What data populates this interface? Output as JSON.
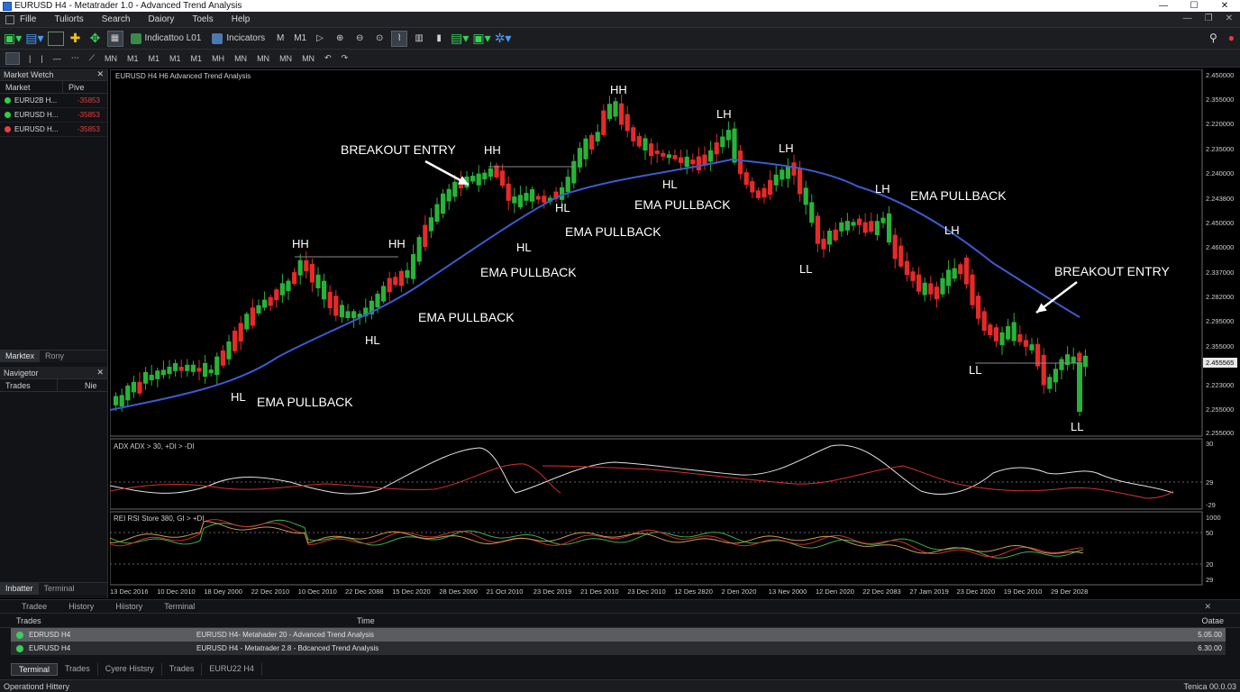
{
  "window": {
    "title": "EURUSD H4 - Metatrader 1.0 - Advanced Trend Analysis"
  },
  "menu": [
    "Fille",
    "Tuliorts",
    "Search",
    "Daiory",
    "Toels",
    "Help"
  ],
  "toolbar": {
    "indicators1": "Indicattoo L01",
    "indicators2": "Incicators",
    "tf_labels": [
      "M",
      "M1"
    ],
    "timeframes": [
      "MN",
      "M1",
      "M1",
      "M1",
      "M1",
      "MH",
      "MN",
      "MN",
      "MN",
      "MN"
    ]
  },
  "market_watch": {
    "title": "Market Wetch",
    "col_market": "Market",
    "col_price": "Pive",
    "rows": [
      {
        "symbol": "EURU2B H...",
        "price": "-35853",
        "color": "#2fcf4a"
      },
      {
        "symbol": "EURUSD H...",
        "price": "-35853",
        "color": "#2fcf4a"
      },
      {
        "symbol": "EURUSD H...",
        "price": "-35853",
        "color": "#e84040"
      }
    ],
    "tabs": [
      "Marktex",
      "Rony"
    ]
  },
  "navigator": {
    "title": "Navigetor",
    "col_trades": "Trades",
    "col_right": "Nie",
    "tabs": [
      "Inbatter",
      "Terminal"
    ]
  },
  "chart": {
    "label": "EURUSD H4  H6  Advanced Trend Analysis",
    "adx_label": "ADX ADX > 30, +DI > -DI",
    "rsi_label": "REI RSI Store 380, GI > +DI",
    "price_axis": [
      "2.450000",
      "2.355000",
      "2.220000",
      "2.235000",
      "2.240000",
      "2.243800",
      "2.450000",
      "2.460000",
      "2.337000",
      "2.282000",
      "2.295000",
      "2.355000",
      "2.455565",
      "2.223000",
      "2.255000",
      "2.255000"
    ],
    "adx_axis": [
      "30",
      "29",
      "-29"
    ],
    "rsi_axis": [
      "1000",
      "50",
      "20",
      "29"
    ],
    "dates": [
      "13 Dec 2016",
      "10 Dec 2010",
      "18 Dey 2000",
      "22 Dec 2010",
      "10 Oec 2010",
      "22 Dec 2088",
      "15 Dec 2020",
      "28 Des 2000",
      "21 Oct 2010",
      "23 Dec 2019",
      "21 Des 2010",
      "23 Dec 2010",
      "12 Des 2820",
      "2 Den 2020",
      "13 Nev 2000",
      "12 Den 2020",
      "22 Dec 2083",
      "27 Jam 2019",
      "23 Dec 2020",
      "19 Dec 2010",
      "29 Der 2028"
    ],
    "current_price": "2.455565",
    "annotations": [
      {
        "text": "HH"
      },
      {
        "text": "HH"
      },
      {
        "text": "HL"
      },
      {
        "text": "HL"
      },
      {
        "text": "EMA PULLBACK"
      },
      {
        "text": "EMA PULLBACK"
      },
      {
        "text": "EMA PULLBACK"
      },
      {
        "text": "BREAKOUT ENTRY"
      },
      {
        "text": "HH"
      },
      {
        "text": "HL"
      },
      {
        "text": "HL"
      },
      {
        "text": "EMA PULLBACK"
      },
      {
        "text": "HH"
      },
      {
        "text": "HL"
      },
      {
        "text": "EMA PULLBACK"
      },
      {
        "text": "LH"
      },
      {
        "text": "LH"
      },
      {
        "text": "LL"
      },
      {
        "text": "LH"
      },
      {
        "text": "EMA PULLBACK"
      },
      {
        "text": "LH"
      },
      {
        "text": "BREAKOUT ENTRY"
      },
      {
        "text": "LL"
      },
      {
        "text": "LL"
      }
    ]
  },
  "terminal": {
    "tabs_top": [
      "Tradee",
      "History",
      "Hiistory",
      "Terminal"
    ],
    "col_trades": "Trades",
    "col_time": "Time",
    "col_value": "Oatae",
    "rows": [
      {
        "symbol": "EDRUSD H4",
        "desc": "EURUSD H4- Metahader 20 - Advanced Trend Analysis",
        "value": "5.05.00"
      },
      {
        "symbol": "EURUSD H4",
        "desc": "EURUSD H4 - Metatrader 2.8 - Bdcanced Trend Analysis",
        "value": "6.30.00"
      }
    ],
    "tabs_bottom": [
      "Terminal",
      "Trades",
      "Cyere Histsry",
      "Trades",
      "EURU22 H4"
    ]
  },
  "status": {
    "left": "Operationd Hittery",
    "right": "Tenica 00.0.03"
  },
  "colors": {
    "bull": "#29b23a",
    "bear": "#e52a2a",
    "ema": "#3a5bd0",
    "background": "#000000"
  }
}
